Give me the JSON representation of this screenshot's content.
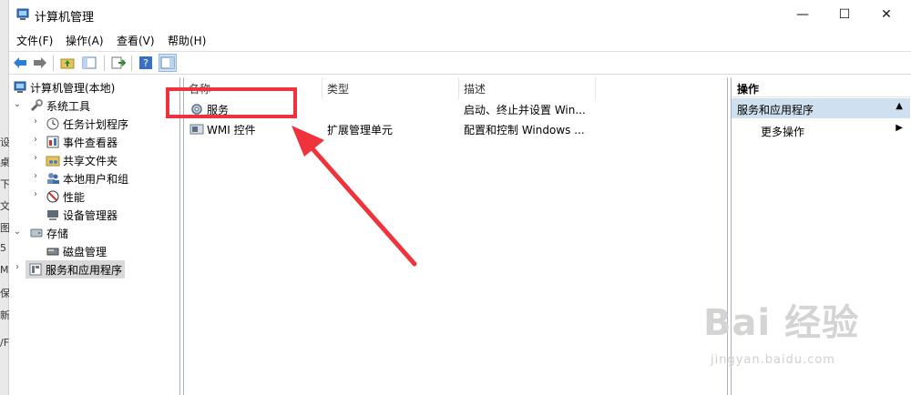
{
  "window": {
    "title": "计算机管理",
    "controls": {
      "minimize": "—",
      "maximize": "☐",
      "close": "✕"
    }
  },
  "desk_strip_chars": [
    "设",
    "桌",
    "下",
    "文",
    "图",
    "5",
    "M",
    "保",
    "新",
    "/F"
  ],
  "menu": [
    "文件(F)",
    "操作(A)",
    "查看(V)",
    "帮助(H)"
  ],
  "toolbar": [
    "back-icon",
    "forward-icon",
    "up-folder-icon",
    "show-hide-tree-icon",
    "export-icon",
    "help-icon",
    "show-action-pane-icon"
  ],
  "tree": {
    "root": "计算机管理(本地)",
    "system_tools": "系统工具",
    "items": [
      "任务计划程序",
      "事件查看器",
      "共享文件夹",
      "本地用户和组",
      "性能",
      "设备管理器"
    ],
    "storage": "存储",
    "disk": "磁盘管理",
    "services_apps": "服务和应用程序"
  },
  "list": {
    "columns": [
      "名称",
      "类型",
      "描述"
    ],
    "rows": [
      {
        "name": "服务",
        "type": "",
        "desc": "启动、终止并设置 Win..."
      },
      {
        "name": "WMI 控件",
        "type": "扩展管理单元",
        "desc": "配置和控制 Windows ..."
      }
    ]
  },
  "actions": {
    "header": "操作",
    "group": "服务和应用程序",
    "more": "更多操作"
  },
  "watermark": {
    "logo": "Bai 经验",
    "url": "jingyan.baidu.com"
  },
  "colors": {
    "annotation": "#f0323c",
    "action_group_bg": "#cfe0f0"
  }
}
